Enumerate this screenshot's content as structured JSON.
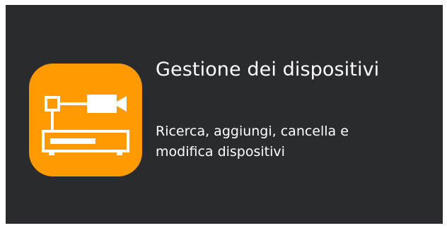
{
  "card": {
    "title": "Gestione dei dispositivi",
    "description": "Ricerca, aggiungi, cancella e modifica dispositivi",
    "icon": "device-management-icon",
    "colors": {
      "background": "#2a2b2f",
      "icon_background": "#ff9a00",
      "icon_foreground": "#ffffff",
      "text": "#ffffff"
    }
  }
}
